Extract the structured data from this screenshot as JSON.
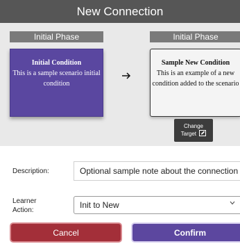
{
  "dialog": {
    "title": "New Connection"
  },
  "source": {
    "phase_label": "Initial Phase",
    "card_title": "Initial Condition",
    "card_text": "This is a sample scenario initial condition"
  },
  "target": {
    "phase_label": "Initial Phase",
    "card_title": "Sample New Condition",
    "card_text": "This is an example of a new condition added to the scenario"
  },
  "change_target": {
    "line1": "Change",
    "line2": "Target",
    "icon": "edit-icon"
  },
  "form": {
    "description_label": "Description:",
    "description_value": "Optional sample note about the connection",
    "learner_action_label": "Learner Action:",
    "learner_action_value": "Init to New"
  },
  "buttons": {
    "cancel": "Cancel",
    "confirm": "Confirm"
  },
  "colors": {
    "title_bar": "#565656",
    "source_card": "#5a47a0",
    "cancel": "#a32f39",
    "confirm": "#5c479f"
  }
}
